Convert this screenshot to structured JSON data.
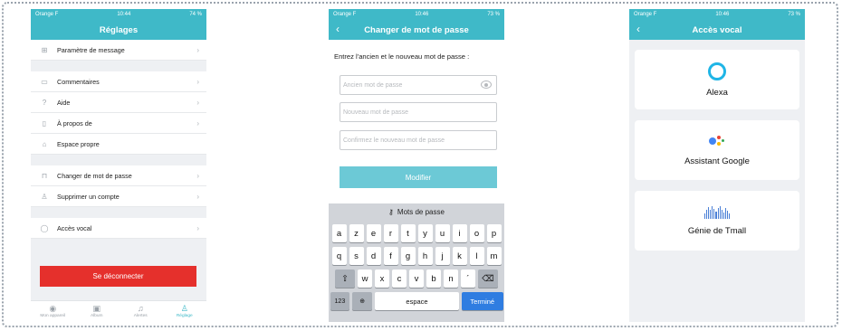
{
  "colors": {
    "accent": "#3fb9c8",
    "danger": "#e5302c",
    "done": "#2f7de1"
  },
  "screen1": {
    "status": {
      "carrier": "Orange F",
      "time": "10:44",
      "battery": "74 %"
    },
    "title": "Réglages",
    "rows": [
      {
        "label": "Paramètre de message",
        "icon": "grid-icon"
      },
      {
        "label": "Commentaires",
        "icon": "chat-icon"
      },
      {
        "label": "Aide",
        "icon": "help-icon"
      },
      {
        "label": "À propos de",
        "icon": "book-icon"
      },
      {
        "label": "Espace propre",
        "icon": "broom-icon"
      },
      {
        "label": "Changer de mot de passe",
        "icon": "lock-icon"
      },
      {
        "label": "Supprimer un compte",
        "icon": "user-icon"
      },
      {
        "label": "Accès vocal",
        "icon": "speech-icon"
      }
    ],
    "logout": "Se déconnecter",
    "tabs": [
      {
        "label": "Mon appareil",
        "icon": "camera-icon"
      },
      {
        "label": "Album",
        "icon": "image-icon"
      },
      {
        "label": "Alertes",
        "icon": "bell-icon"
      },
      {
        "label": "Réglage",
        "icon": "person-icon"
      }
    ]
  },
  "screen2": {
    "status": {
      "carrier": "Orange F",
      "time": "10:46",
      "battery": "73 %"
    },
    "title": "Changer de mot de passe",
    "prompt": "Entrez l'ancien et le nouveau mot de passe :",
    "placeholders": {
      "old": "Ancien mot de passe",
      "new": "Nouveau mot de passe",
      "confirm": "Confirmez le nouveau mot de passe"
    },
    "submit": "Modifier",
    "keyboard": {
      "bar": "Mots de passe",
      "row1": [
        "a",
        "z",
        "e",
        "r",
        "t",
        "y",
        "u",
        "i",
        "o",
        "p"
      ],
      "row2": [
        "q",
        "s",
        "d",
        "f",
        "g",
        "h",
        "j",
        "k",
        "l",
        "m"
      ],
      "row3": [
        "w",
        "x",
        "c",
        "v",
        "b",
        "n",
        "´"
      ],
      "numbers": "123",
      "space": "espace",
      "done": "Terminé"
    }
  },
  "screen3": {
    "status": {
      "carrier": "Orange F",
      "time": "10:46",
      "battery": "73 %"
    },
    "title": "Accès vocal",
    "cards": [
      {
        "name": "Alexa",
        "icon": "alexa-icon"
      },
      {
        "name": "Assistant Google",
        "icon": "google-assistant-icon"
      },
      {
        "name": "Génie de Tmall",
        "icon": "tmall-genie-icon"
      }
    ]
  }
}
